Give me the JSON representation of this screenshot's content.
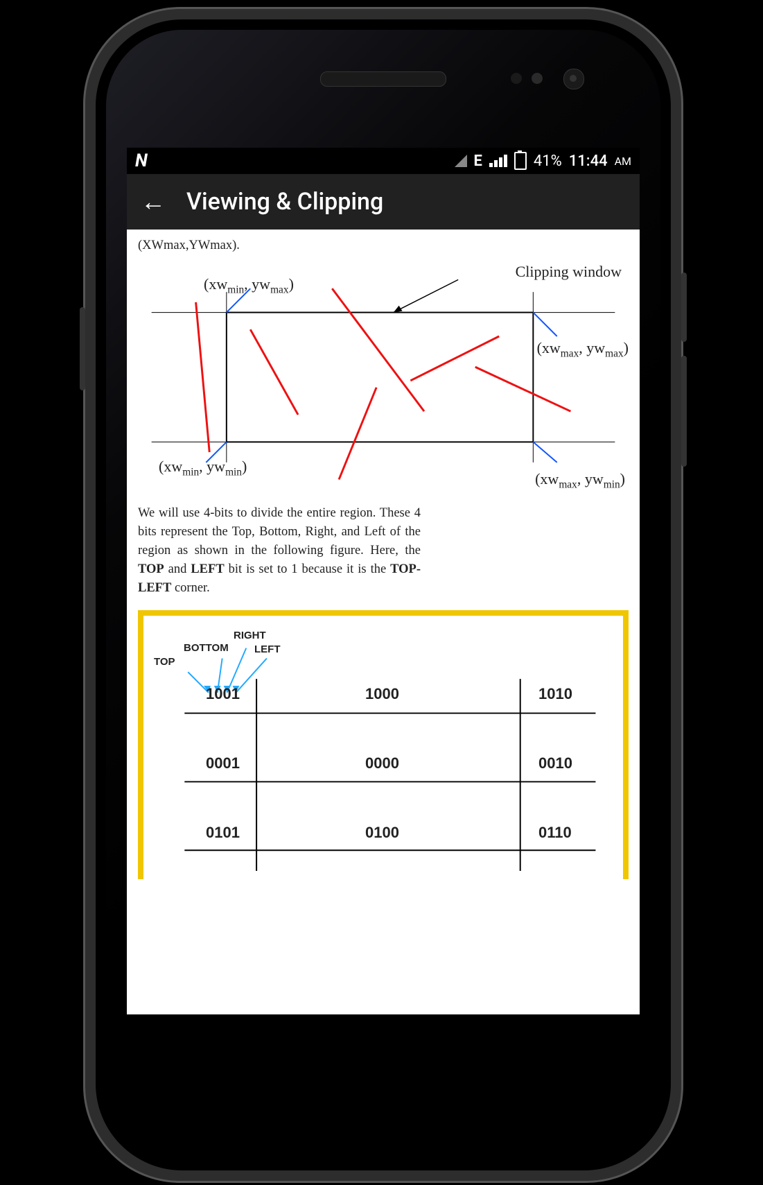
{
  "statusbar": {
    "logo": "N",
    "network": "E",
    "battery": "41%",
    "time": "11:44",
    "ampm": "AM"
  },
  "appbar": {
    "title": "Viewing & Clipping"
  },
  "doc": {
    "partial_top": "(XWmax,YWmax).",
    "fig1": {
      "clipping_window": "Clipping window",
      "tl": "(xw_min, yw_max)",
      "tr": "(xw_max, yw_max)",
      "bl": "(xw_min, yw_min)",
      "br": "(xw_max, yw_min)"
    },
    "para_pre": "We will use 4-bits to divide the entire region. These 4 bits represent the Top, Bottom, Right, and Left of the region as shown in the following figure. Here, the ",
    "top": "TOP",
    "and": " and ",
    "left": "LEFT",
    "mid": " bit is set to 1 because it is the ",
    "topleft": "TOP-LEFT",
    "end": " corner.",
    "fig2": {
      "lbl_top": "TOP",
      "lbl_bottom": "BOTTOM",
      "lbl_right": "RIGHT",
      "lbl_left": "LEFT",
      "codes": {
        "tl": "1001",
        "tc": "1000",
        "tr": "1010",
        "ml": "0001",
        "mc": "0000",
        "mr": "0010",
        "bl": "0101",
        "bc": "0100",
        "br": "0110"
      }
    }
  }
}
